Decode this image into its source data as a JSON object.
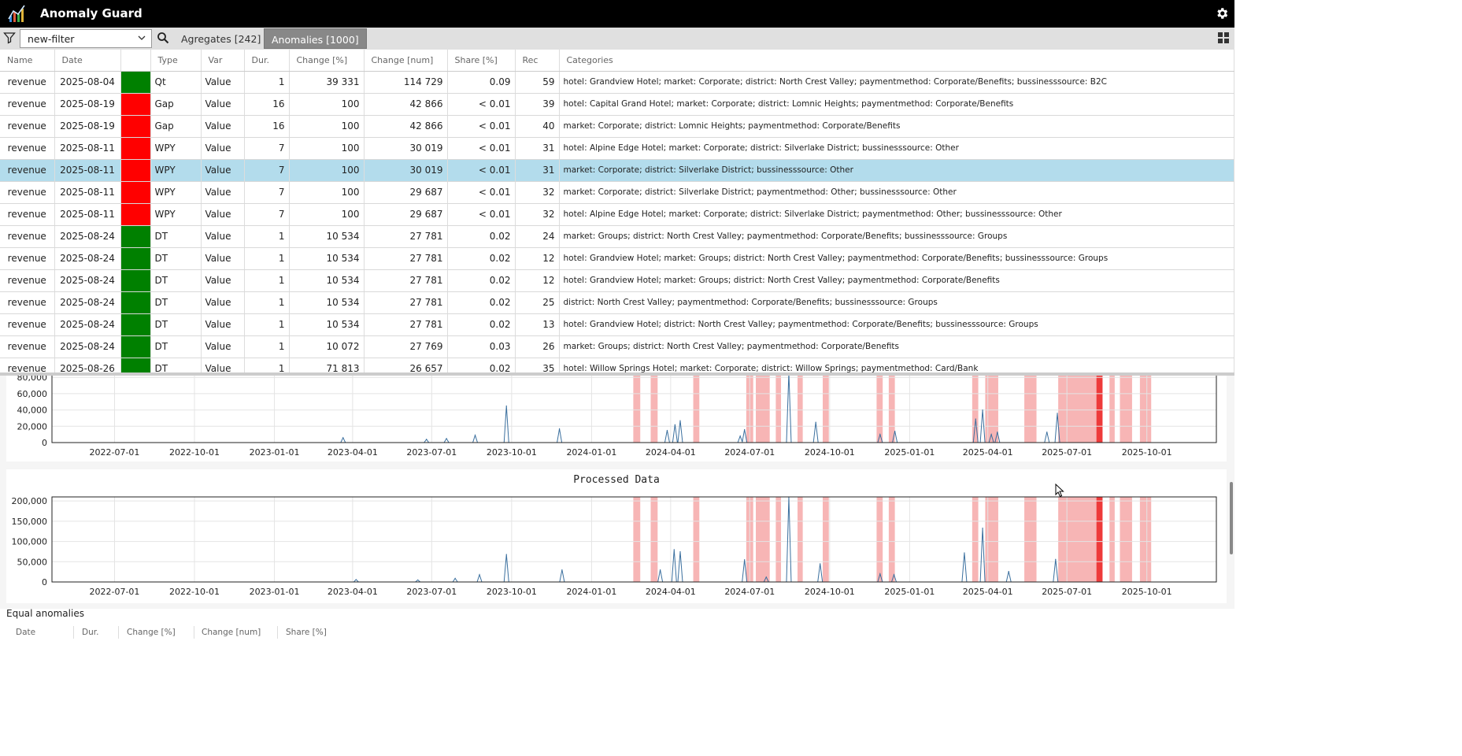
{
  "app": {
    "title": "Anomaly Guard"
  },
  "toolbar": {
    "filter_value": "new-filter",
    "tabs": [
      {
        "label": "Agregates [242]",
        "active": false
      },
      {
        "label": "Anomalies [1000]",
        "active": true
      }
    ]
  },
  "table": {
    "columns": [
      "Name",
      "Date",
      "",
      "Type",
      "Var",
      "Dur.",
      "Change [%]",
      "Change [num]",
      "Share [%]",
      "Rec",
      "Categories"
    ],
    "rows": [
      {
        "name": "revenue",
        "date": "2025-08-04",
        "color": "green",
        "type": "Qt",
        "var": "Value",
        "dur": "1",
        "change_pct": "39 331",
        "change_num": "114 729",
        "share": "0.09",
        "rec": "59",
        "categories": "hotel: Grandview Hotel; market: Corporate; district: North Crest Valley; paymentmethod: Corporate/Benefits; bussinesssource: B2C"
      },
      {
        "name": "revenue",
        "date": "2025-08-19",
        "color": "red",
        "type": "Gap",
        "var": "Value",
        "dur": "16",
        "change_pct": "100",
        "change_num": "42 866",
        "share": "< 0.01",
        "rec": "39",
        "categories": "hotel: Capital Grand Hotel; market: Corporate; district: Lomnic Heights; paymentmethod: Corporate/Benefits"
      },
      {
        "name": "revenue",
        "date": "2025-08-19",
        "color": "red",
        "type": "Gap",
        "var": "Value",
        "dur": "16",
        "change_pct": "100",
        "change_num": "42 866",
        "share": "< 0.01",
        "rec": "40",
        "categories": "market: Corporate; district: Lomnic Heights; paymentmethod: Corporate/Benefits"
      },
      {
        "name": "revenue",
        "date": "2025-08-11",
        "color": "red",
        "type": "WPY",
        "var": "Value",
        "dur": "7",
        "change_pct": "100",
        "change_num": "30 019",
        "share": "< 0.01",
        "rec": "31",
        "categories": "hotel: Alpine Edge Hotel; market: Corporate; district: Silverlake District; bussinesssource: Other"
      },
      {
        "name": "revenue",
        "date": "2025-08-11",
        "color": "red",
        "type": "WPY",
        "var": "Value",
        "dur": "7",
        "change_pct": "100",
        "change_num": "30 019",
        "share": "< 0.01",
        "rec": "31",
        "categories": "market: Corporate; district: Silverlake District; bussinesssource: Other",
        "selected": true
      },
      {
        "name": "revenue",
        "date": "2025-08-11",
        "color": "red",
        "type": "WPY",
        "var": "Value",
        "dur": "7",
        "change_pct": "100",
        "change_num": "29 687",
        "share": "< 0.01",
        "rec": "32",
        "categories": "market: Corporate; district: Silverlake District; paymentmethod: Other; bussinesssource: Other"
      },
      {
        "name": "revenue",
        "date": "2025-08-11",
        "color": "red",
        "type": "WPY",
        "var": "Value",
        "dur": "7",
        "change_pct": "100",
        "change_num": "29 687",
        "share": "< 0.01",
        "rec": "32",
        "categories": "hotel: Alpine Edge Hotel; market: Corporate; district: Silverlake District; paymentmethod: Other; bussinesssource: Other"
      },
      {
        "name": "revenue",
        "date": "2025-08-24",
        "color": "green",
        "type": "DT",
        "var": "Value",
        "dur": "1",
        "change_pct": "10 534",
        "change_num": "27 781",
        "share": "0.02",
        "rec": "24",
        "categories": "market: Groups; district: North Crest Valley; paymentmethod: Corporate/Benefits; bussinesssource: Groups"
      },
      {
        "name": "revenue",
        "date": "2025-08-24",
        "color": "green",
        "type": "DT",
        "var": "Value",
        "dur": "1",
        "change_pct": "10 534",
        "change_num": "27 781",
        "share": "0.02",
        "rec": "12",
        "categories": "hotel: Grandview Hotel; market: Groups; district: North Crest Valley; paymentmethod: Corporate/Benefits; bussinesssource: Groups"
      },
      {
        "name": "revenue",
        "date": "2025-08-24",
        "color": "green",
        "type": "DT",
        "var": "Value",
        "dur": "1",
        "change_pct": "10 534",
        "change_num": "27 781",
        "share": "0.02",
        "rec": "12",
        "categories": "hotel: Grandview Hotel; market: Groups; district: North Crest Valley; paymentmethod: Corporate/Benefits"
      },
      {
        "name": "revenue",
        "date": "2025-08-24",
        "color": "green",
        "type": "DT",
        "var": "Value",
        "dur": "1",
        "change_pct": "10 534",
        "change_num": "27 781",
        "share": "0.02",
        "rec": "25",
        "categories": "district: North Crest Valley; paymentmethod: Corporate/Benefits; bussinesssource: Groups"
      },
      {
        "name": "revenue",
        "date": "2025-08-24",
        "color": "green",
        "type": "DT",
        "var": "Value",
        "dur": "1",
        "change_pct": "10 534",
        "change_num": "27 781",
        "share": "0.02",
        "rec": "13",
        "categories": "hotel: Grandview Hotel; district: North Crest Valley; paymentmethod: Corporate/Benefits; bussinesssource: Groups"
      },
      {
        "name": "revenue",
        "date": "2025-08-24",
        "color": "green",
        "type": "DT",
        "var": "Value",
        "dur": "1",
        "change_pct": "10 072",
        "change_num": "27 769",
        "share": "0.03",
        "rec": "26",
        "categories": "market: Groups; district: North Crest Valley; paymentmethod: Corporate/Benefits"
      },
      {
        "name": "revenue",
        "date": "2025-08-26",
        "color": "green",
        "type": "DT",
        "var": "Value",
        "dur": "1",
        "change_pct": "71 813",
        "change_num": "26 657",
        "share": "0.02",
        "rec": "35",
        "categories": "hotel: Willow Springs Hotel; market: Corporate; district: Willow Springs; paymentmethod: Card/Bank"
      }
    ]
  },
  "colors": {
    "green": "#008000",
    "red": "#ff0000",
    "selected_row": "#b3dcec",
    "line": "#3a6f9e",
    "anomaly_band": "#f7b5b5",
    "anomaly_highlight": "#ee3a3a"
  },
  "chart_data": [
    {
      "type": "line",
      "title": "",
      "x_tick_labels": [
        "2022-07-01",
        "2022-10-01",
        "2023-01-01",
        "2023-04-01",
        "2023-07-01",
        "2023-10-01",
        "2024-01-01",
        "2024-04-01",
        "2024-07-01",
        "2024-10-01",
        "2025-01-01",
        "2025-04-01",
        "2025-07-01",
        "2025-10-01"
      ],
      "y_tick_labels": [
        "0",
        "20,000",
        "40,000",
        "60,000",
        "80,000"
      ],
      "ylim": [
        0,
        86000
      ],
      "xlim": [
        "2022-04-20",
        "2025-12-20"
      ],
      "peaks": [
        {
          "x": "2023-03-21",
          "y": 6000
        },
        {
          "x": "2023-06-25",
          "y": 4000
        },
        {
          "x": "2023-07-18",
          "y": 5000
        },
        {
          "x": "2023-08-20",
          "y": 9000
        },
        {
          "x": "2023-09-25",
          "y": 45000
        },
        {
          "x": "2023-11-25",
          "y": 17000
        },
        {
          "x": "2024-03-28",
          "y": 15000
        },
        {
          "x": "2024-04-06",
          "y": 22000
        },
        {
          "x": "2024-04-12",
          "y": 27000
        },
        {
          "x": "2024-06-20",
          "y": 8000
        },
        {
          "x": "2024-06-25",
          "y": 16000
        },
        {
          "x": "2024-08-15",
          "y": 86000
        },
        {
          "x": "2024-09-15",
          "y": 25000
        },
        {
          "x": "2024-11-28",
          "y": 10000
        },
        {
          "x": "2024-12-15",
          "y": 14000
        },
        {
          "x": "2025-03-18",
          "y": 29000
        },
        {
          "x": "2025-03-26",
          "y": 40000
        },
        {
          "x": "2025-04-05",
          "y": 10000
        },
        {
          "x": "2025-04-12",
          "y": 13000
        },
        {
          "x": "2025-06-08",
          "y": 13000
        },
        {
          "x": "2025-06-20",
          "y": 36000
        }
      ],
      "anomaly_bands": [
        {
          "from": "2024-02-18",
          "to": "2024-02-26"
        },
        {
          "from": "2024-03-09",
          "to": "2024-03-17"
        },
        {
          "from": "2024-04-27",
          "to": "2024-05-04"
        },
        {
          "from": "2024-06-27",
          "to": "2024-07-05"
        },
        {
          "from": "2024-07-08",
          "to": "2024-07-24"
        },
        {
          "from": "2024-07-31",
          "to": "2024-08-06"
        },
        {
          "from": "2024-08-25",
          "to": "2024-08-31"
        },
        {
          "from": "2024-09-23",
          "to": "2024-09-30"
        },
        {
          "from": "2024-11-24",
          "to": "2024-12-01"
        },
        {
          "from": "2024-12-08",
          "to": "2024-12-15"
        },
        {
          "from": "2025-03-14",
          "to": "2025-03-21"
        },
        {
          "from": "2025-03-29",
          "to": "2025-04-13"
        },
        {
          "from": "2025-05-13",
          "to": "2025-05-27"
        },
        {
          "from": "2025-06-21",
          "to": "2025-08-04"
        },
        {
          "from": "2025-08-04",
          "to": "2025-08-11"
        },
        {
          "from": "2025-08-19",
          "to": "2025-08-25"
        },
        {
          "from": "2025-08-31",
          "to": "2025-09-14"
        },
        {
          "from": "2025-09-23",
          "to": "2025-10-06"
        }
      ],
      "highlight_band": {
        "from": "2025-08-04",
        "to": "2025-08-11"
      }
    },
    {
      "type": "line",
      "title": "Processed Data",
      "x_tick_labels": [
        "2022-07-01",
        "2022-10-01",
        "2023-01-01",
        "2023-04-01",
        "2023-07-01",
        "2023-10-01",
        "2024-01-01",
        "2024-04-01",
        "2024-07-01",
        "2024-10-01",
        "2025-01-01",
        "2025-04-01",
        "2025-07-01",
        "2025-10-01"
      ],
      "y_tick_labels": [
        "0",
        "50,000",
        "100,000",
        "150,000",
        "200,000"
      ],
      "ylim": [
        0,
        210000
      ],
      "xlim": [
        "2022-04-20",
        "2025-12-20"
      ],
      "peaks": [
        {
          "x": "2023-04-05",
          "y": 6000
        },
        {
          "x": "2023-06-15",
          "y": 5000
        },
        {
          "x": "2023-07-28",
          "y": 9000
        },
        {
          "x": "2023-08-25",
          "y": 18000
        },
        {
          "x": "2023-09-25",
          "y": 68000
        },
        {
          "x": "2023-11-28",
          "y": 30000
        },
        {
          "x": "2024-03-20",
          "y": 30000
        },
        {
          "x": "2024-04-05",
          "y": 80000
        },
        {
          "x": "2024-04-12",
          "y": 75000
        },
        {
          "x": "2024-06-25",
          "y": 55000
        },
        {
          "x": "2024-07-20",
          "y": 12000
        },
        {
          "x": "2024-08-15",
          "y": 210000
        },
        {
          "x": "2024-09-20",
          "y": 45000
        },
        {
          "x": "2024-11-28",
          "y": 20000
        },
        {
          "x": "2024-12-14",
          "y": 18000
        },
        {
          "x": "2025-03-05",
          "y": 72000
        },
        {
          "x": "2025-03-26",
          "y": 133000
        },
        {
          "x": "2025-04-25",
          "y": 26000
        },
        {
          "x": "2025-06-18",
          "y": 56000
        }
      ],
      "anomaly_bands": [
        {
          "from": "2024-02-18",
          "to": "2024-02-26"
        },
        {
          "from": "2024-03-09",
          "to": "2024-03-17"
        },
        {
          "from": "2024-04-27",
          "to": "2024-05-04"
        },
        {
          "from": "2024-06-27",
          "to": "2024-07-05"
        },
        {
          "from": "2024-07-08",
          "to": "2024-07-24"
        },
        {
          "from": "2024-07-31",
          "to": "2024-08-06"
        },
        {
          "from": "2024-08-25",
          "to": "2024-08-31"
        },
        {
          "from": "2024-09-23",
          "to": "2024-09-30"
        },
        {
          "from": "2024-11-24",
          "to": "2024-12-01"
        },
        {
          "from": "2024-12-08",
          "to": "2024-12-15"
        },
        {
          "from": "2025-03-14",
          "to": "2025-03-21"
        },
        {
          "from": "2025-03-29",
          "to": "2025-04-13"
        },
        {
          "from": "2025-05-13",
          "to": "2025-05-27"
        },
        {
          "from": "2025-06-21",
          "to": "2025-08-04"
        },
        {
          "from": "2025-08-04",
          "to": "2025-08-11"
        },
        {
          "from": "2025-08-19",
          "to": "2025-08-25"
        },
        {
          "from": "2025-08-31",
          "to": "2025-09-14"
        },
        {
          "from": "2025-09-23",
          "to": "2025-10-06"
        }
      ],
      "highlight_band": {
        "from": "2025-08-04",
        "to": "2025-08-11"
      }
    }
  ],
  "equal_anomalies": {
    "label": "Equal anomalies",
    "columns": [
      "Date",
      "Dur.",
      "Change [%]",
      "Change [num]",
      "Share [%]"
    ]
  }
}
